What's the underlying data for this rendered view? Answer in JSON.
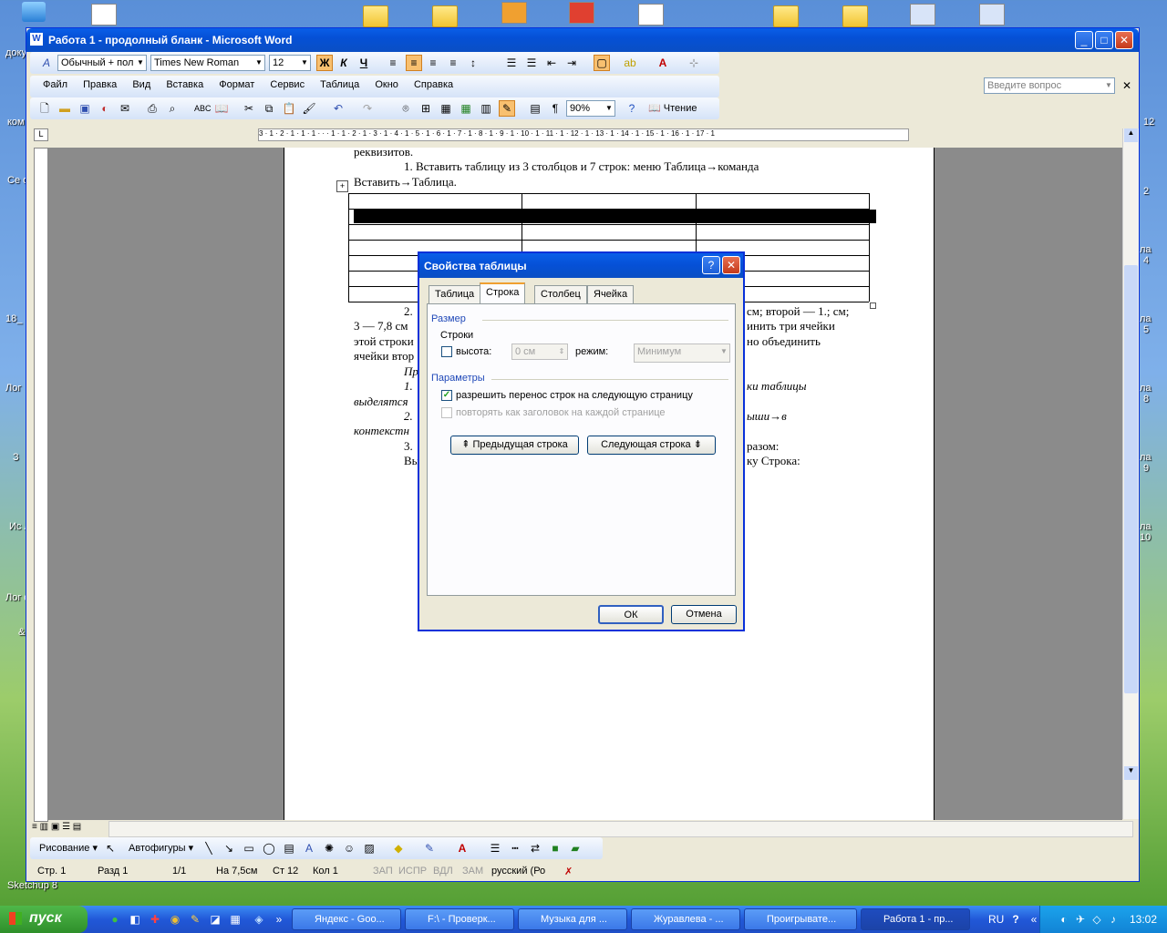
{
  "desktop": {
    "labels": [
      "доку",
      "ком",
      "Се окр",
      "18_",
      "Лог",
      "З",
      "Ис ли",
      "Лог фун",
      "&",
      "Sketchup 8",
      "12",
      "2",
      "4",
      "5",
      "8",
      "9",
      "10",
      "2",
      "ла",
      "ла",
      "ла",
      "ла",
      "ла"
    ]
  },
  "window": {
    "title": "Работа 1 - продолный бланк - Microsoft Word",
    "min": "_",
    "max": "□",
    "close": "✕"
  },
  "format_toolbar": {
    "style": "Обычный + пол",
    "font": "Times New Roman",
    "size": "12",
    "bold": "Ж",
    "italic": "К",
    "underline": "Ч"
  },
  "menu": {
    "items": [
      "Файл",
      "Правка",
      "Вид",
      "Вставка",
      "Формат",
      "Сервис",
      "Таблица",
      "Окно",
      "Справка"
    ],
    "help_placeholder": "Введите вопрос",
    "close": "✕"
  },
  "std_toolbar": {
    "zoom": "90%",
    "reading": "Чтение"
  },
  "ruler": {
    "text": "3 · 1 · 2 · 1 · 1 · 1 · · · 1 · 1 · 2 · 1 · 3 · 1 · 4 · 1 · 5 · 1 · 6 · 1 · 7 · 1 · 8 · 1 · 9 · 1 · 10 · 1 · 11 · 1 · 12 · 1 · 13 · 1 · 14 · 1 · 15 · 1 · 16 · 1 · 17 · 1"
  },
  "document": {
    "l1": "реквизитов.",
    "l2": "1. Вставить таблицу  из 3 столбцов и 7 строк: меню Таблица→команда",
    "l3": "Вставить→Таблица.",
    "l4a": "2.",
    "l4b": "см; второй — 1.; см;",
    "l5a": "3 — 7,8 см",
    "l5b": "инить три ячейки",
    "l6a": "этой строки",
    "l6b": "но объединить",
    "l7a": "ячейки втор",
    "l8a": "Пр",
    "l9a": "1.",
    "l9b": "ки таблицы",
    "l10a": "выделятся",
    "l11a": "2.",
    "l11b": "ыши→в",
    "l12a": "контекстн",
    "l13a": "3.",
    "l13b": "разом:",
    "l14a": "Вы",
    "l14b": "ку Строка:"
  },
  "dialog": {
    "title": "Свойства таблицы",
    "help": "?",
    "close": "✕",
    "tabs": [
      "Таблица",
      "Строка",
      "Столбец",
      "Ячейка"
    ],
    "section_size": "Размер",
    "rows_label": "Строки",
    "height_label": "высота:",
    "height_value": "0 см",
    "mode_label": "режим:",
    "mode_value": "Минимум",
    "section_params": "Параметры",
    "allow_break": "разрешить перенос строк на следующую страницу",
    "allow_break_checked": true,
    "repeat_header": "повторять как заголовок на каждой странице",
    "prev_row": "Предыдущая строка",
    "next_row": "Следующая строка",
    "ok": "ОК",
    "cancel": "Отмена"
  },
  "drawing_toolbar": {
    "draw": "Рисование",
    "autoshapes": "Автофигуры"
  },
  "status": {
    "page": "Стр. 1",
    "section": "Разд 1",
    "pages": "1/1",
    "at": "На 7,5см",
    "line": "Ст 12",
    "col": "Кол 1",
    "rec": "ЗАП",
    "trk": "ИСПР",
    "ext": "ВДЛ",
    "ovr": "ЗАМ",
    "lang": "русский (Ро"
  },
  "taskbar": {
    "start": "пуск",
    "tasks": [
      "Яндекс - Goo...",
      "F:\\ - Проверк...",
      "Музыка для ...",
      "Журавлева - ...",
      "Проигрывате...",
      "Работа 1 - пр..."
    ],
    "lang": "RU",
    "clock": "13:02"
  }
}
